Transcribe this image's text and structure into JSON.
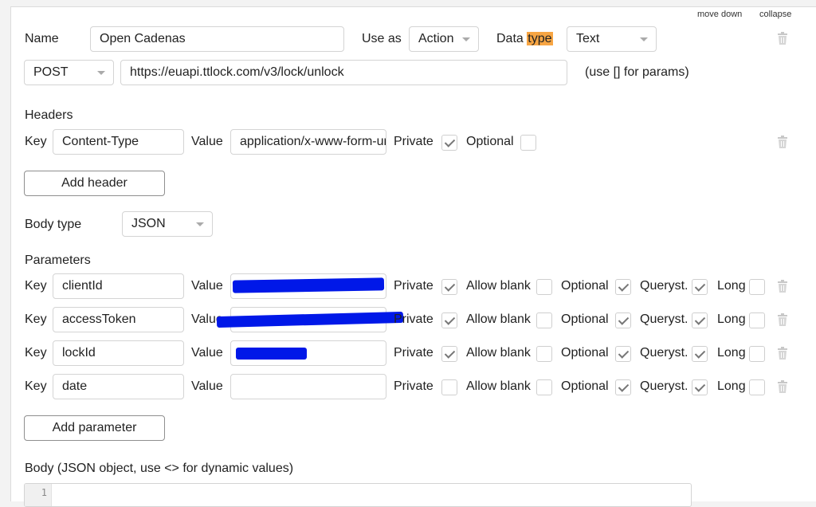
{
  "top_links": {
    "move_down": "move down",
    "collapse": "collapse"
  },
  "call": {
    "name_label": "Name",
    "name_value": "Open Cadenas",
    "use_as_label": "Use as",
    "use_as_value": "Action",
    "data_label": "Data",
    "type_label": "type",
    "data_type_value": "Text",
    "method_value": "POST",
    "url_value": "https://euapi.ttlock.com/v3/lock/unlock",
    "url_hint": "(use [] for params)"
  },
  "headers": {
    "title": "Headers",
    "key_label": "Key",
    "value_label": "Value",
    "private_label": "Private",
    "optional_label": "Optional",
    "items": [
      {
        "key": "Content-Type",
        "value": "application/x-www-form-urlencoded",
        "private": true,
        "optional": false
      }
    ],
    "add_label": "Add header"
  },
  "body_type": {
    "label": "Body type",
    "value": "JSON"
  },
  "parameters": {
    "title": "Parameters",
    "key_label": "Key",
    "value_label": "Value",
    "private_label": "Private",
    "allow_blank_label": "Allow blank",
    "optional_label": "Optional",
    "queryst_label": "Queryst.",
    "long_label": "Long",
    "items": [
      {
        "key": "clientId",
        "value": "",
        "redacted": true,
        "private": true,
        "allow_blank": false,
        "optional": true,
        "queryst": true,
        "long": false
      },
      {
        "key": "accessToken",
        "value": "",
        "redacted": true,
        "private": true,
        "allow_blank": false,
        "optional": true,
        "queryst": true,
        "long": false
      },
      {
        "key": "lockId",
        "value": "",
        "redacted": true,
        "private": true,
        "allow_blank": false,
        "optional": true,
        "queryst": true,
        "long": false
      },
      {
        "key": "date",
        "value": "",
        "redacted": false,
        "private": false,
        "allow_blank": false,
        "optional": true,
        "queryst": true,
        "long": false
      }
    ],
    "add_label": "Add parameter"
  },
  "body": {
    "label": "Body (JSON object, use <> for dynamic values)",
    "line_number": "1"
  },
  "colors": {
    "highlight": "#f7a543",
    "redaction": "#0018e8"
  },
  "icons": {
    "delete": "trash-icon",
    "dropdown": "chevron-down-icon",
    "check": "checkmark-icon"
  }
}
